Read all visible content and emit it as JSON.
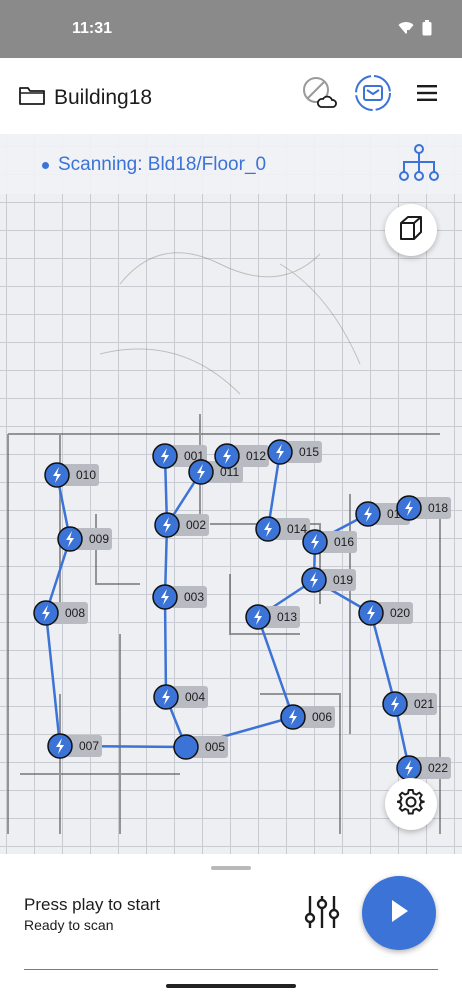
{
  "status_bar": {
    "time": "11:31",
    "icons": [
      "wifi-icon",
      "battery-icon"
    ]
  },
  "app_bar": {
    "title": "Building18",
    "icons": [
      "folder-icon",
      "cloud-off-icon",
      "scanner-icon",
      "menu-icon"
    ],
    "accent_color": "#3b73d6"
  },
  "scan": {
    "text": "Scanning: Bld18/Floor_0"
  },
  "graph": {
    "node_color": "#3b73d6",
    "nodes": [
      {
        "id": "001",
        "label": "001"
      },
      {
        "id": "002",
        "label": "002"
      },
      {
        "id": "003",
        "label": "003"
      },
      {
        "id": "004",
        "label": "004"
      },
      {
        "id": "005",
        "label": "005"
      },
      {
        "id": "006",
        "label": "006"
      },
      {
        "id": "007",
        "label": "007"
      },
      {
        "id": "008",
        "label": "008"
      },
      {
        "id": "009",
        "label": "009"
      },
      {
        "id": "010",
        "label": "010"
      },
      {
        "id": "011",
        "label": "011"
      },
      {
        "id": "012",
        "label": "012"
      },
      {
        "id": "013",
        "label": "013"
      },
      {
        "id": "014",
        "label": "014"
      },
      {
        "id": "015",
        "label": "015"
      },
      {
        "id": "016",
        "label": "016"
      },
      {
        "id": "017",
        "label": "017"
      },
      {
        "id": "018",
        "label": "018"
      },
      {
        "id": "019",
        "label": "019"
      },
      {
        "id": "020",
        "label": "020"
      },
      {
        "id": "021",
        "label": "021"
      },
      {
        "id": "022",
        "label": "022"
      }
    ]
  },
  "bottom": {
    "title": "Press play to start",
    "subtitle": "Ready to scan"
  }
}
